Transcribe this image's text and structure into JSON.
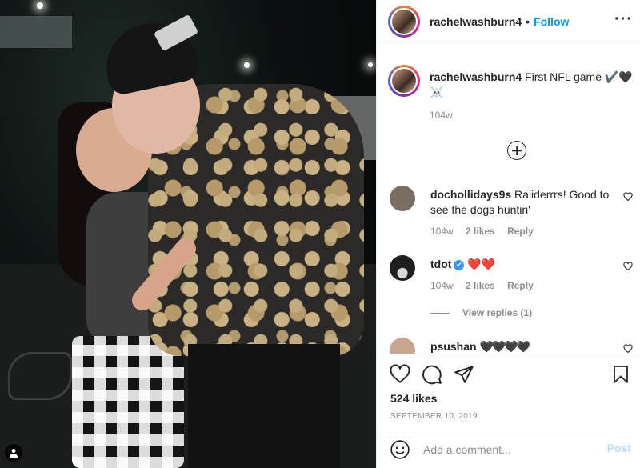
{
  "post": {
    "username": "rachelwashburn4",
    "follow_label": "Follow",
    "separator": "•",
    "more_label": "···",
    "user_tag_icon": "person-icon"
  },
  "caption": {
    "username": "rachelwashburn4",
    "text": "First NFL game ✔️🖤☠️",
    "time": "104w"
  },
  "comments": [
    {
      "username": "dochollidays9s",
      "text": "Raiiderrrs! Good to see the dogs huntin'",
      "time": "104w",
      "likes": "2 likes",
      "reply": "Reply",
      "avatar_color": "#7a6d62"
    },
    {
      "username": "tdot",
      "verified": "✔",
      "text": "❤️❤️",
      "time": "104w",
      "likes": "2 likes",
      "reply": "Reply",
      "avatar_color": "#222222",
      "view_replies": "View replies (1)"
    },
    {
      "username": "psushan",
      "text": "🖤🖤🖤🖤",
      "avatar_color": "#c8a690"
    }
  ],
  "actions": {
    "likes": "524 likes",
    "date": "SEPTEMBER 10, 2019"
  },
  "add_comment": {
    "placeholder": "Add a comment...",
    "post_label": "Post"
  },
  "colors": {
    "link_blue": "#0095f6",
    "post_disabled": "#b2dffc",
    "muted_text": "#8e8e8e"
  }
}
